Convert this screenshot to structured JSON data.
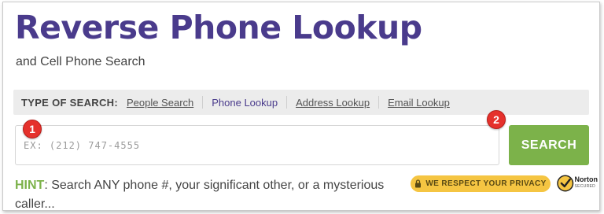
{
  "header": {
    "title": "Reverse Phone Lookup",
    "subtitle": "and Cell Phone Search"
  },
  "search_type": {
    "label": "TYPE OF SEARCH:",
    "options": [
      {
        "label": "People Search",
        "active": false
      },
      {
        "label": "Phone Lookup",
        "active": true
      },
      {
        "label": "Address Lookup",
        "active": false
      },
      {
        "label": "Email Lookup",
        "active": false
      }
    ]
  },
  "search": {
    "placeholder": "EX: (212) 747-4555",
    "value": "",
    "button_label": "SEARCH"
  },
  "markers": {
    "input_marker": "1",
    "button_marker": "2"
  },
  "hint": {
    "label": "HINT",
    "text": ": Search ANY phone #, your significant other, or a mysterious caller..."
  },
  "privacy": {
    "badge_text": "WE RESPECT YOUR PRIVACY",
    "icon": "lock-icon"
  },
  "norton": {
    "name": "Norton",
    "sub": "SECURED",
    "icon": "norton-check-icon"
  },
  "colors": {
    "title": "#4a3b8c",
    "active_tab": "#4a3b8c",
    "search_button": "#7cb24a",
    "hint_label": "#7cb24a",
    "privacy_badge": "#f5c542",
    "marker": "#e5312c"
  }
}
